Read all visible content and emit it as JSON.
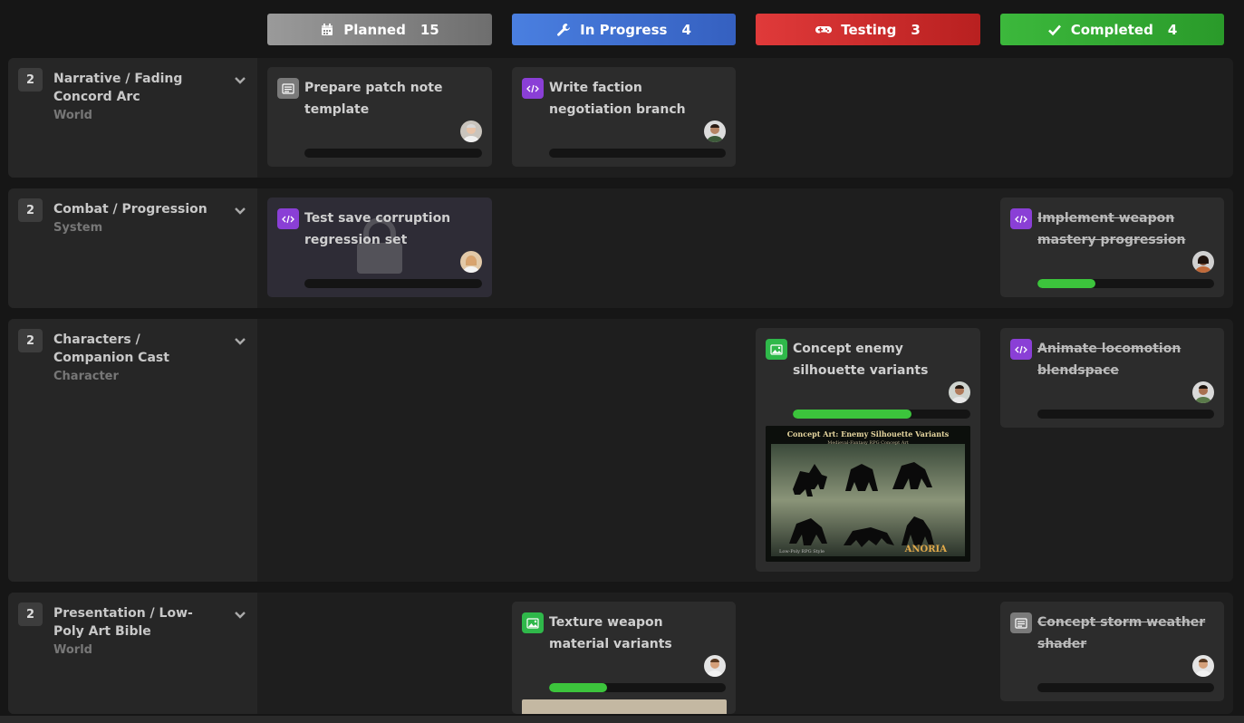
{
  "columns": [
    {
      "label": "Planned",
      "count": "15",
      "icon": "calendar-icon"
    },
    {
      "label": "In Progress",
      "count": "4",
      "icon": "wrench-icon"
    },
    {
      "label": "Testing",
      "count": "3",
      "icon": "gamepad-icon"
    },
    {
      "label": "Completed",
      "count": "4",
      "icon": "check-icon"
    }
  ],
  "rows": [
    {
      "count": "2",
      "title": "Narrative / Fading Concord Arc",
      "category": "World",
      "cards": [
        {
          "column": "Planned",
          "type_icon": "document-icon",
          "title": "Prepare patch note template",
          "progress": 0
        },
        {
          "column": "In Progress",
          "type_icon": "code-icon",
          "title": "Write faction negotiation branch",
          "progress": 0
        }
      ]
    },
    {
      "count": "2",
      "title": "Combat / Progression",
      "category": "System",
      "cards": [
        {
          "column": "Planned",
          "type_icon": "code-icon",
          "title": "Test save corruption regression set",
          "progress": 0,
          "locked": true
        },
        {
          "column": "Completed",
          "type_icon": "code-icon",
          "title": "Implement weapon mastery progression",
          "progress": 0.33,
          "completed": true
        }
      ]
    },
    {
      "count": "2",
      "title": "Characters / Companion Cast",
      "category": "Character",
      "cards": [
        {
          "column": "Testing",
          "type_icon": "image-icon",
          "title": "Concept enemy silhouette variants",
          "progress": 0.67,
          "thumbnail": {
            "title": "Concept Art: Enemy Silhouette Variants",
            "subtitle": "Medieval-Fantasy RPG Concept Art",
            "caption": "Low-Poly RPG Style",
            "logo": "ANORIA"
          }
        },
        {
          "column": "Completed",
          "type_icon": "code-icon",
          "title": "Animate locomotion blendspace",
          "progress": 0,
          "completed": true
        }
      ]
    },
    {
      "count": "2",
      "title": "Presentation / Low-Poly Art Bible",
      "category": "World",
      "cards": [
        {
          "column": "In Progress",
          "type_icon": "image-icon",
          "title": "Texture weapon material variants",
          "progress": 0.33
        },
        {
          "column": "Completed",
          "type_icon": "document-icon",
          "title": "Concept storm weather shader",
          "progress": 0,
          "completed": true
        }
      ]
    }
  ],
  "colors": {
    "planned": "#8a8a8a",
    "in_progress": "#3f6fd6",
    "testing": "#d22c2c",
    "completed": "#33a833",
    "progress_fill": "#3cc43c"
  }
}
